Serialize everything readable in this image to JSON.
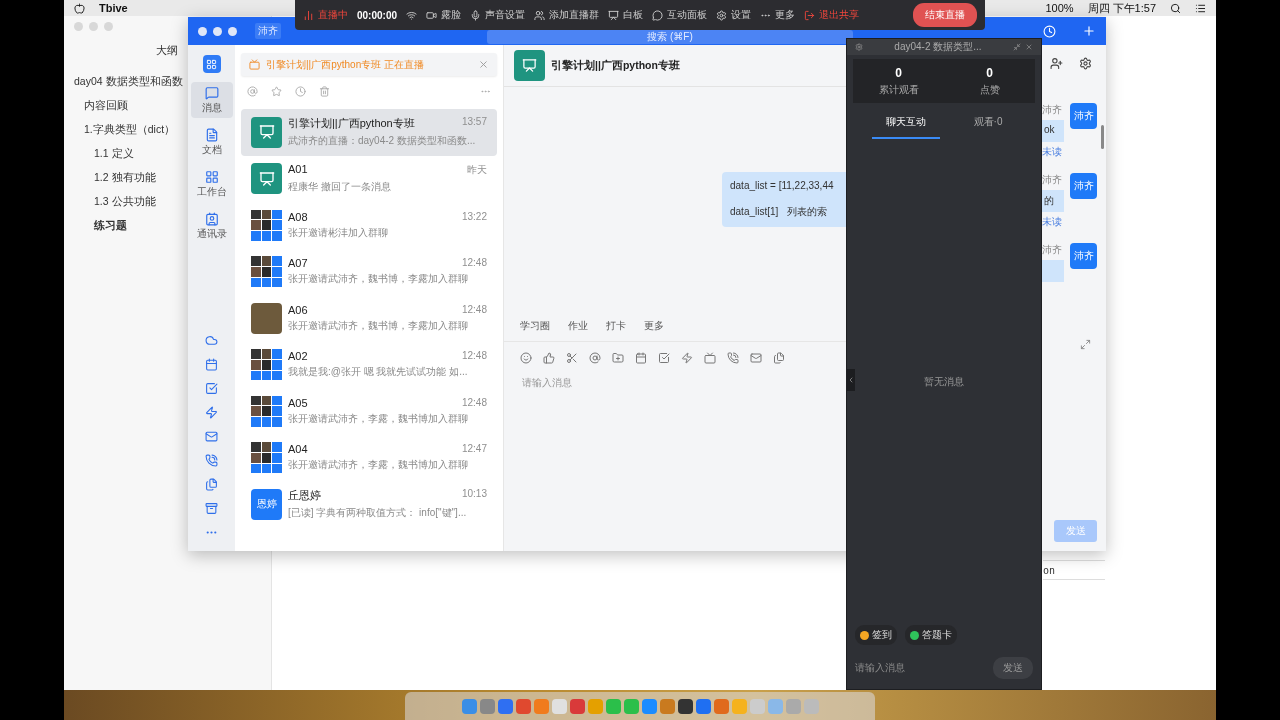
{
  "menubar": {
    "app_name": "Tbive",
    "battery": "100%",
    "clock": "周四 下午1:57"
  },
  "outline_window": {
    "heading": "大纲",
    "items": [
      {
        "label": "day04 数据类型和函数",
        "selected": false,
        "children": [
          {
            "label": "内容回顾",
            "selected": false
          },
          {
            "label": "1.字典类型（dict）",
            "selected": false,
            "children": [
              {
                "label": "1.1 定义",
                "selected": false
              },
              {
                "label": "1.2 独有功能",
                "selected": false
              },
              {
                "label": "1.3 公共功能",
                "selected": false
              },
              {
                "label": "练习题",
                "selected": true
              }
            ]
          }
        ]
      }
    ],
    "fragment": "on"
  },
  "chat_window": {
    "account_badge": "沛齐",
    "search_placeholder": "搜索 (⌘F)",
    "nav": [
      {
        "label": "消息",
        "kind": "message",
        "selected": true
      },
      {
        "label": "文档",
        "kind": "doc",
        "selected": false
      },
      {
        "label": "工作台",
        "kind": "apps",
        "selected": false
      },
      {
        "label": "通讯录",
        "kind": "contacts",
        "selected": false
      }
    ],
    "live_banner": "引擎计划||广西python专班 正在直播",
    "conversations": [
      {
        "name": "引擎计划||广西python专班",
        "time": "13:57",
        "preview": "武沛齐的直播：day04-2 数据类型和函数...",
        "kind": "app",
        "selected": true
      },
      {
        "name": "A01",
        "time": "昨天",
        "preview": "程康华 撤回了一条消息",
        "kind": "app",
        "selected": false
      },
      {
        "name": "A08",
        "time": "13:22",
        "preview": "张开邀请彬沣加入群聊",
        "kind": "mosaic",
        "selected": false
      },
      {
        "name": "A07",
        "time": "12:48",
        "preview": "张开邀请武沛齐，魏书博，李露加入群聊",
        "kind": "mosaic",
        "selected": false
      },
      {
        "name": "A06",
        "time": "12:48",
        "preview": "张开邀请武沛齐，魏书博，李露加入群聊",
        "kind": "photo",
        "selected": false
      },
      {
        "name": "A02",
        "time": "12:48",
        "preview": "我就是我:@张开 嗯 我就先试试功能 如...",
        "kind": "mosaic",
        "selected": false
      },
      {
        "name": "A05",
        "time": "12:48",
        "preview": "张开邀请武沛齐，李露，魏书博加入群聊",
        "kind": "mosaic",
        "selected": false
      },
      {
        "name": "A04",
        "time": "12:47",
        "preview": "张开邀请武沛齐，李露，魏书博加入群聊",
        "kind": "mosaic",
        "selected": false
      },
      {
        "name": "丘恩婷",
        "time": "10:13",
        "preview": "[已读] 字典有两种取值方式： info[\"键\"]...",
        "kind": "text",
        "avatar_text": "恩婷",
        "selected": false
      }
    ],
    "chat": {
      "title": "引擎计划||广西python专班",
      "message_lines": [
        "data_list = [11,22,33,44",
        "data_list[1]   列表的索"
      ],
      "quick_tabs": [
        "学习圈",
        "作业",
        "打卡",
        "更多"
      ],
      "input_placeholder": "请输入消息",
      "side_messages": [
        {
          "sender": "沛齐",
          "text": "ok",
          "status": "未读",
          "avatar": "沛齐"
        },
        {
          "sender": "沛齐",
          "text": "的",
          "status": "未读",
          "avatar": "沛齐"
        },
        {
          "sender": "沛齐",
          "avatar": "沛齐"
        }
      ],
      "send": {
        "label": "发送",
        "disabled": true
      }
    }
  },
  "live_toolbar": {
    "items": [
      {
        "kind": "live",
        "label": "直播中"
      },
      {
        "kind": "timer",
        "label": "00:00:00"
      },
      {
        "kind": "camera",
        "label": "露脸"
      },
      {
        "kind": "mic",
        "label": "声音设置"
      },
      {
        "kind": "group",
        "label": "添加直播群"
      },
      {
        "kind": "board",
        "label": "白板"
      },
      {
        "kind": "panel",
        "label": "互动面板"
      },
      {
        "kind": "settings",
        "label": "设置"
      },
      {
        "kind": "more",
        "label": "更多"
      },
      {
        "kind": "exit",
        "label": "退出共享"
      },
      {
        "kind": "end",
        "label": "结束直播"
      }
    ]
  },
  "live_panel": {
    "title": "day04-2 数据类型...",
    "stats": [
      {
        "value": "0",
        "label": "累计观看"
      },
      {
        "value": "0",
        "label": "点赞"
      }
    ],
    "tabs": [
      {
        "label": "聊天互动",
        "selected": true
      },
      {
        "label": "观看·0",
        "selected": false
      }
    ],
    "empty_text": "暂无消息",
    "actions": [
      {
        "label": "签到",
        "color": "#f5a623"
      },
      {
        "label": "答题卡",
        "color": "#2fc25b"
      }
    ],
    "input_placeholder": "请输入消息",
    "send": "发送"
  }
}
